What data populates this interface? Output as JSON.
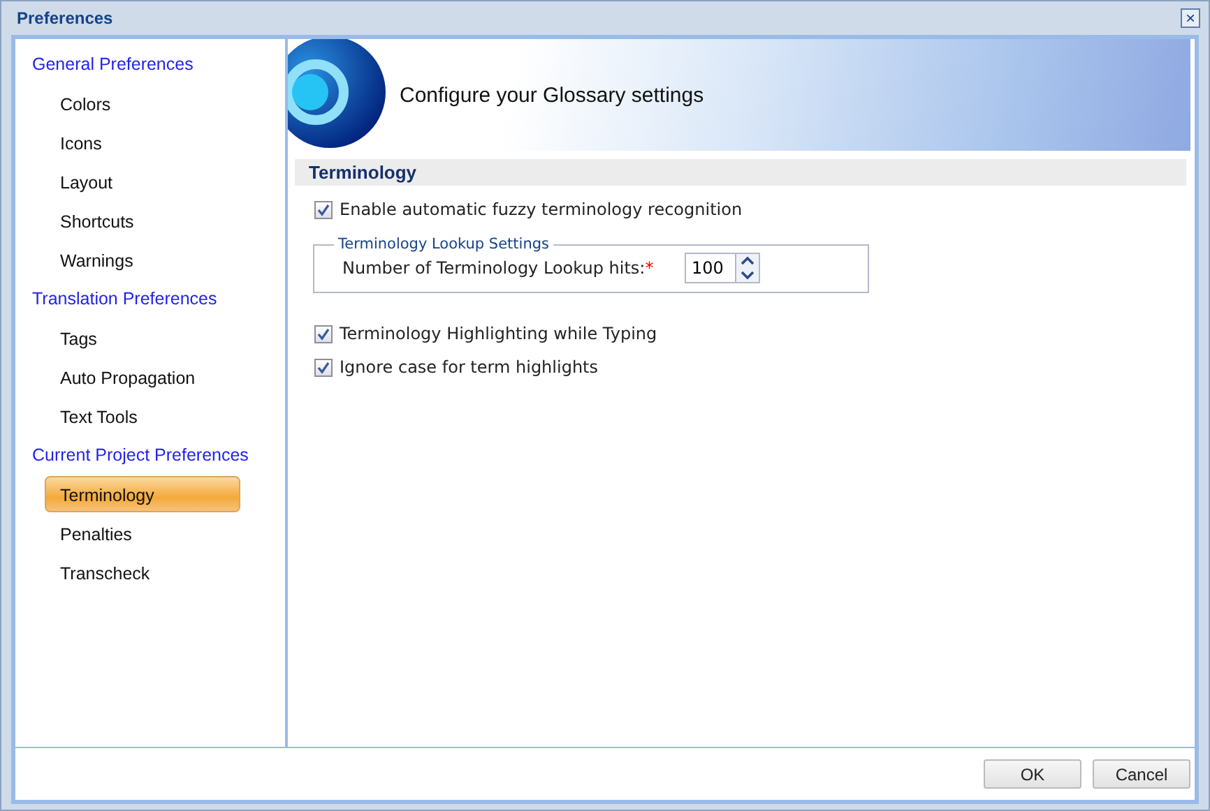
{
  "window": {
    "title": "Preferences",
    "close": "×"
  },
  "sidebar": {
    "groups": [
      {
        "label": "General Preferences",
        "items": [
          {
            "label": "Colors",
            "selected": false
          },
          {
            "label": "Icons",
            "selected": false
          },
          {
            "label": "Layout",
            "selected": false
          },
          {
            "label": "Shortcuts",
            "selected": false
          },
          {
            "label": "Warnings",
            "selected": false
          }
        ]
      },
      {
        "label": "Translation Preferences",
        "items": [
          {
            "label": "Tags",
            "selected": false
          },
          {
            "label": "Auto Propagation",
            "selected": false
          },
          {
            "label": "Text Tools",
            "selected": false
          }
        ]
      },
      {
        "label": "Current Project Preferences",
        "items": [
          {
            "label": "Terminology",
            "selected": true
          },
          {
            "label": "Penalties",
            "selected": false
          },
          {
            "label": "Transcheck",
            "selected": false
          }
        ]
      }
    ]
  },
  "banner": {
    "title": "Configure your Glossary settings"
  },
  "section": {
    "title": "Terminology"
  },
  "options_top": [
    {
      "label": "Enable automatic fuzzy terminology recognition",
      "checked": true
    }
  ],
  "lookup": {
    "legend": "Terminology Lookup Settings",
    "label": "Number of Terminology Lookup hits:",
    "required_mark": "*",
    "value": "100"
  },
  "options_bottom": [
    {
      "label": "Terminology Highlighting while Typing",
      "checked": true
    },
    {
      "label": "Ignore case for term highlights",
      "checked": true
    }
  ],
  "buttons": [
    {
      "label": "OK"
    },
    {
      "label": "Cancel"
    }
  ]
}
